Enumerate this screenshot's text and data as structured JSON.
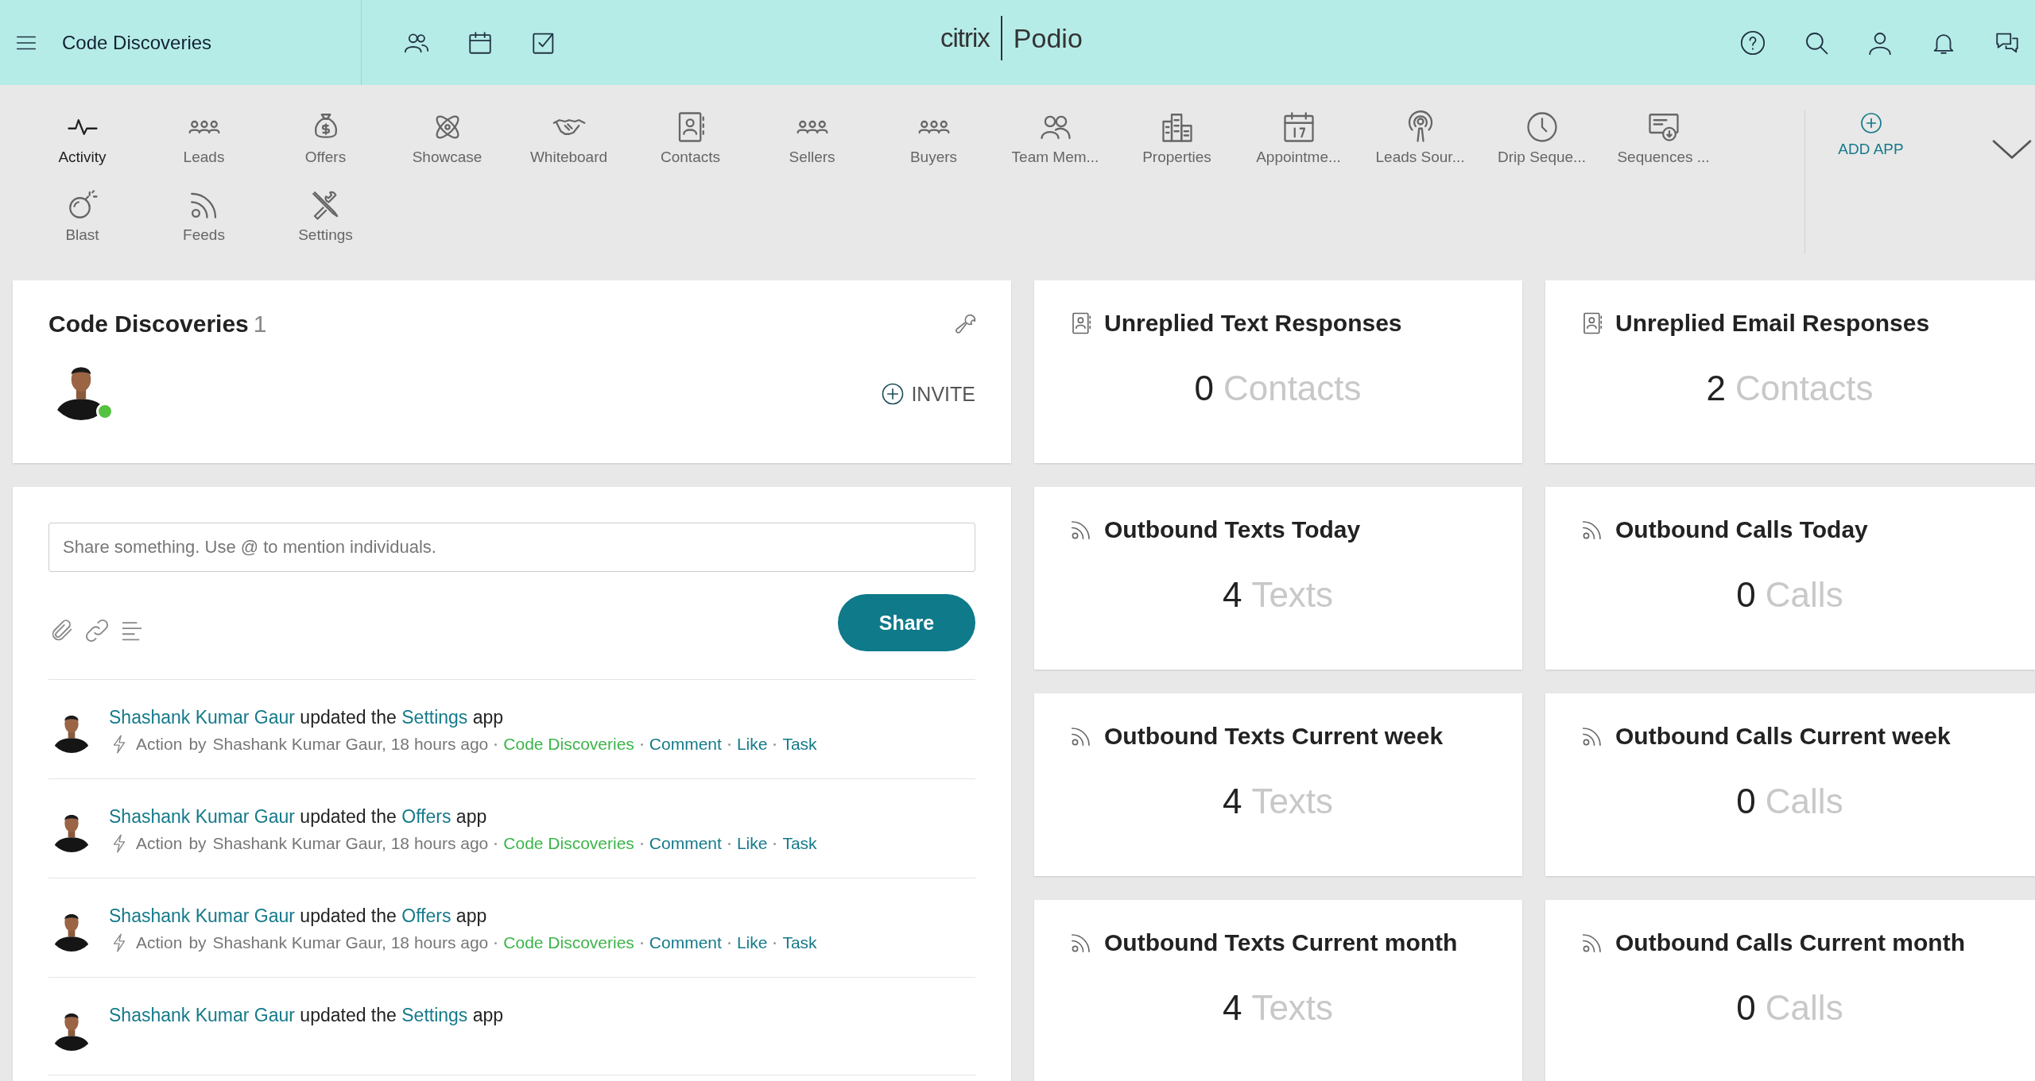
{
  "header": {
    "workspace": "Code Discoveries",
    "logo_brand": "citrix",
    "logo_product": "Podio"
  },
  "apps": [
    {
      "label": "Activity",
      "selected": true
    },
    {
      "label": "Leads",
      "selected": false
    },
    {
      "label": "Offers",
      "selected": false
    },
    {
      "label": "Showcase",
      "selected": false
    },
    {
      "label": "Whiteboard",
      "selected": false
    },
    {
      "label": "Contacts",
      "selected": false
    },
    {
      "label": "Sellers",
      "selected": false
    },
    {
      "label": "Buyers",
      "selected": false
    },
    {
      "label": "Team Mem...",
      "selected": false
    },
    {
      "label": "Properties",
      "selected": false
    },
    {
      "label": "Appointme...",
      "selected": false
    },
    {
      "label": "Leads Sour...",
      "selected": false
    },
    {
      "label": "Drip Seque...",
      "selected": false
    },
    {
      "label": "Sequences ...",
      "selected": false
    },
    {
      "label": "Blast",
      "selected": false
    },
    {
      "label": "Feeds",
      "selected": false
    },
    {
      "label": "Settings",
      "selected": false
    }
  ],
  "add_app": "ADD APP",
  "workspace_card": {
    "title": "Code Discoveries",
    "member_count": "1",
    "members": [
      {
        "online": true
      }
    ],
    "invite": "INVITE"
  },
  "composer": {
    "placeholder": "Share something. Use @ to mention individuals.",
    "share": "Share"
  },
  "activity": [
    {
      "user": "Shashank Kumar Gaur",
      "verb": "updated the",
      "app": "Settings",
      "suffix": "app",
      "meta": {
        "type": "Action",
        "by": "by",
        "author_time": "Shashank Kumar Gaur, 18 hours ago",
        "space": "Code Discoveries",
        "actions": [
          "Comment",
          "Like",
          "Task"
        ]
      }
    },
    {
      "user": "Shashank Kumar Gaur",
      "verb": "updated the",
      "app": "Offers",
      "suffix": "app",
      "meta": {
        "type": "Action",
        "by": "by",
        "author_time": "Shashank Kumar Gaur, 18 hours ago",
        "space": "Code Discoveries",
        "actions": [
          "Comment",
          "Like",
          "Task"
        ]
      }
    },
    {
      "user": "Shashank Kumar Gaur",
      "verb": "updated the",
      "app": "Offers",
      "suffix": "app",
      "meta": {
        "type": "Action",
        "by": "by",
        "author_time": "Shashank Kumar Gaur, 18 hours ago",
        "space": "Code Discoveries",
        "actions": [
          "Comment",
          "Like",
          "Task"
        ]
      }
    },
    {
      "user": "Shashank Kumar Gaur",
      "verb": "updated the",
      "app": "Settings",
      "suffix": "app"
    }
  ],
  "stats": [
    {
      "kind": "contacts",
      "title": "Unreplied Text Responses",
      "value": "0",
      "unit": "Contacts"
    },
    {
      "kind": "contacts",
      "title": "Unreplied Email Responses",
      "value": "2",
      "unit": "Contacts"
    },
    {
      "kind": "feed",
      "title": "Outbound Texts Today",
      "value": "4",
      "unit": "Texts"
    },
    {
      "kind": "feed",
      "title": "Outbound Calls Today",
      "value": "0",
      "unit": "Calls"
    },
    {
      "kind": "feed",
      "title": "Outbound Texts Current week",
      "value": "4",
      "unit": "Texts"
    },
    {
      "kind": "feed",
      "title": "Outbound Calls Current week",
      "value": "0",
      "unit": "Calls"
    },
    {
      "kind": "feed",
      "title": "Outbound Texts Current month",
      "value": "4",
      "unit": "Texts"
    },
    {
      "kind": "feed",
      "title": "Outbound Calls Current month",
      "value": "0",
      "unit": "Calls"
    }
  ]
}
